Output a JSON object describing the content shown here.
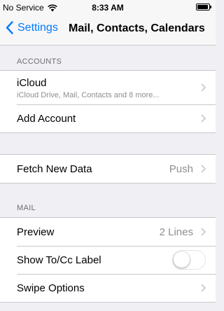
{
  "status_bar": {
    "carrier": "No Service",
    "time": "8:33 AM",
    "wifi_icon": "wifi-icon",
    "battery_icon": "battery-icon"
  },
  "nav": {
    "back_label": "Settings",
    "title": "Mail, Contacts, Calendars"
  },
  "accounts": {
    "header": "ACCOUNTS",
    "items": [
      {
        "label": "iCloud",
        "sublabel": "iCloud Drive, Mail, Contacts and 8 more..."
      },
      {
        "label": "Add Account"
      }
    ]
  },
  "fetch": {
    "label": "Fetch New Data",
    "value": "Push"
  },
  "mail": {
    "header": "MAIL",
    "preview": {
      "label": "Preview",
      "value": "2 Lines"
    },
    "show_to_cc": {
      "label": "Show To/Cc Label",
      "enabled": false
    },
    "swipe_options": {
      "label": "Swipe Options"
    }
  },
  "colors": {
    "accent": "#007aff",
    "background": "#efeff4",
    "separator": "#c8c7cc",
    "secondary_text": "#8e8e93"
  }
}
